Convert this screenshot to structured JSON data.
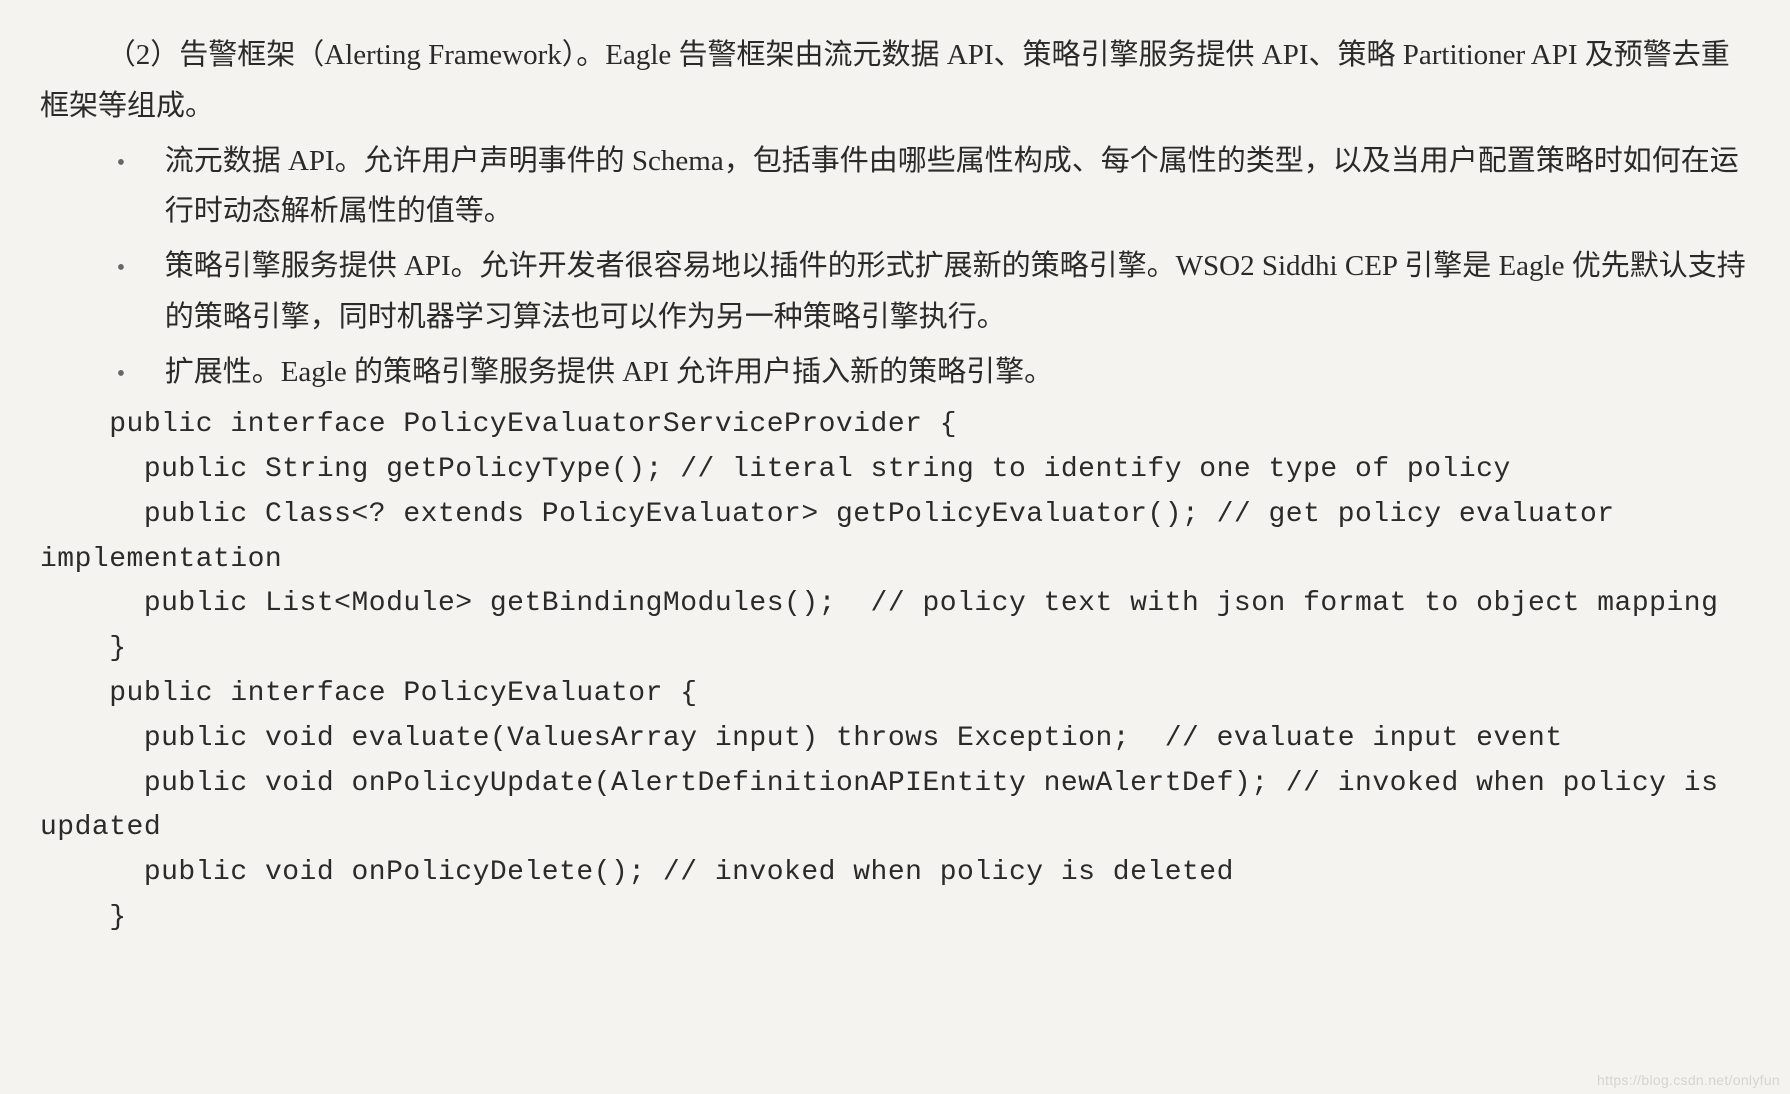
{
  "intro": "（2）告警框架（Alerting Framework）。Eagle 告警框架由流元数据 API、策略引擎服务提供 API、策略 Partitioner API 及预警去重框架等组成。",
  "bullets": [
    "流元数据 API。允许用户声明事件的 Schema，包括事件由哪些属性构成、每个属性的类型，以及当用户配置策略时如何在运行时动态解析属性的值等。",
    "策略引擎服务提供 API。允许开发者很容易地以插件的形式扩展新的策略引擎。WSO2 Siddhi CEP 引擎是 Eagle 优先默认支持的策略引擎，同时机器学习算法也可以作为另一种策略引擎执行。",
    "扩展性。Eagle 的策略引擎服务提供 API 允许用户插入新的策略引擎。"
  ],
  "code": "    public interface PolicyEvaluatorServiceProvider {\n      public String getPolicyType(); // literal string to identify one type of policy\n      public Class<? extends PolicyEvaluator> getPolicyEvaluator(); // get policy evaluator implementation\n      public List<Module> getBindingModules();  // policy text with json format to object mapping\n    }\n    public interface PolicyEvaluator {\n      public void evaluate(ValuesArray input) throws Exception;  // evaluate input event\n      public void onPolicyUpdate(AlertDefinitionAPIEntity newAlertDef); // invoked when policy is updated\n      public void onPolicyDelete(); // invoked when policy is deleted\n    }",
  "watermark": "https://blog.csdn.net/onlyfun"
}
